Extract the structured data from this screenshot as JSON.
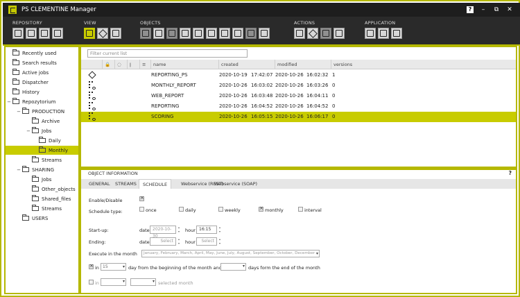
{
  "app": {
    "title": "PS CLEMENTINE Manager",
    "help_label": "?",
    "minimize_glyph": "–",
    "restore_glyph": "⧉",
    "close_glyph": "✕"
  },
  "ribbon": {
    "groups": [
      {
        "label": "REPOSITORY"
      },
      {
        "label": "VIEW"
      },
      {
        "label": "OBJECTS"
      },
      {
        "label": "ACTIONS"
      },
      {
        "label": "APPLICATION"
      }
    ]
  },
  "sidebar": {
    "items": [
      {
        "label": "Recently used"
      },
      {
        "label": "Search results"
      },
      {
        "label": "Active jobs"
      },
      {
        "label": "Dispatcher"
      },
      {
        "label": "History"
      },
      {
        "label": "Repozytorium",
        "toggle": "−"
      },
      {
        "label": "PRODUCTION",
        "toggle": "−"
      },
      {
        "label": "Archive"
      },
      {
        "label": "Jobs",
        "toggle": "−"
      },
      {
        "label": "Daily"
      },
      {
        "label": "Monthly"
      },
      {
        "label": "Streams"
      },
      {
        "label": "SHARING",
        "toggle": "−"
      },
      {
        "label": "Jobs"
      },
      {
        "label": "Other_objects"
      },
      {
        "label": "Shared_files"
      },
      {
        "label": "Streams"
      },
      {
        "label": "USERS"
      }
    ]
  },
  "list": {
    "filter_placeholder": "Filter current list",
    "columns": {
      "name": "name",
      "created": "created",
      "modified": "modified",
      "versions": "versions"
    },
    "rows": [
      {
        "icon": "diamond-icon",
        "name": "REPORTING_PS",
        "created_date": "2020-10-19",
        "created_time": "17:42:07",
        "modified_date": "2020-10-26",
        "modified_time": "16:02:32",
        "versions": "1"
      },
      {
        "icon": "flow-icon",
        "name": "MONTHLY_REPORT",
        "created_date": "2020-10-26",
        "created_time": "16:03:02",
        "modified_date": "2020-10-26",
        "modified_time": "16:03:26",
        "versions": "0"
      },
      {
        "icon": "flow-icon",
        "name": "WEB_REPORT",
        "created_date": "2020-10-26",
        "created_time": "16:03:48",
        "modified_date": "2020-10-26",
        "modified_time": "16:04:11",
        "versions": "0"
      },
      {
        "icon": "flow-icon",
        "name": "REPORTING",
        "created_date": "2020-10-26",
        "created_time": "16:04:52",
        "modified_date": "2020-10-26",
        "modified_time": "16:04:52",
        "versions": "0"
      },
      {
        "icon": "flow-icon",
        "name": "SCORING",
        "created_date": "2020-10-26",
        "created_time": "16:05:15",
        "modified_date": "2020-10-26",
        "modified_time": "16:06:17",
        "versions": "0",
        "selected": true
      }
    ]
  },
  "object_info": {
    "title": "OBJECT INFORMATION",
    "help": "?",
    "tabs": [
      "GENERAL",
      "STREAMS",
      "SCHEDULE",
      "Webservice (REST)",
      "Webservice (SOAP)"
    ],
    "active_tab": "SCHEDULE",
    "schedule": {
      "enable_label": "Enable/Disable",
      "type_label": "Schedule type:",
      "types": [
        "once",
        "daily",
        "weekly",
        "monthly",
        "interval"
      ],
      "selected_type": "monthly",
      "startup_label": "Start-up:",
      "ending_label": "Ending:",
      "date_label": "date",
      "hour_label": "hour",
      "startup_date": "2020-10-30",
      "startup_hour": "16:15",
      "ending_date": "Select",
      "ending_hour": "Select",
      "execute_label": "Execute in the month",
      "months_value": "January, February, March, April, May, June, July, August, September, October, December",
      "in_label": "in",
      "day_value": "15",
      "day_text": "day from the beginning of the month and/or in",
      "days_end_text": "days form the end of the month",
      "in2_label": "in",
      "selected_month_text": "selected month"
    }
  },
  "colors": {
    "accent": "#c8cc00",
    "border": "#b5b800",
    "title_bg": "#1e1e1e",
    "ribbon_bg": "#2a2a2a"
  }
}
